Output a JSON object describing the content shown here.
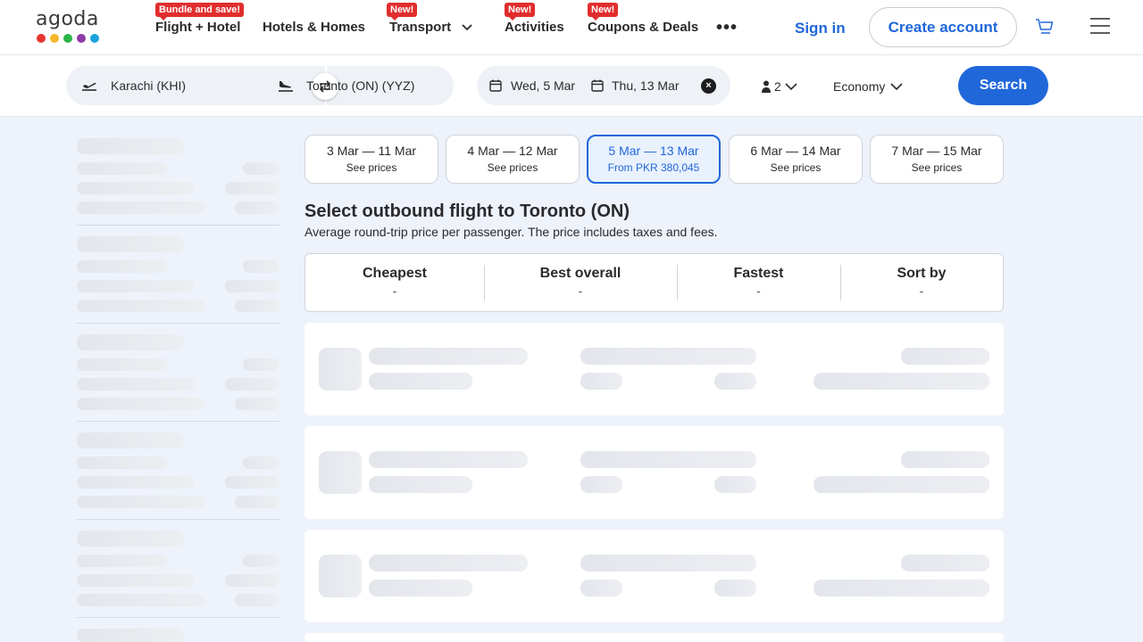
{
  "header": {
    "logo": {
      "text": "agoda",
      "dots": [
        "#e8352f",
        "#f6b82a",
        "#2cb34a",
        "#8e3ba6",
        "#1ca3de"
      ]
    },
    "nav": [
      {
        "label": "Flight + Hotel",
        "badge": "Bundle and save!"
      },
      {
        "label": "Hotels & Homes",
        "badge": ""
      },
      {
        "label": "Transport",
        "badge": "New!",
        "has_dropdown": true
      },
      {
        "label": "Activities",
        "badge": "New!"
      },
      {
        "label": "Coupons & Deals",
        "badge": "New!"
      }
    ],
    "more_label": "•••",
    "sign_in": "Sign in",
    "create_account": "Create account"
  },
  "search": {
    "from": "Karachi (KHI)",
    "to": "Toronto (ON) (YYZ)",
    "depart": "Wed, 5 Mar",
    "return": "Thu, 13 Mar",
    "clear_icon": "×",
    "passengers": "2",
    "cabin": "Economy",
    "button": "Search"
  },
  "date_options": [
    {
      "range": "3 Mar — 11 Mar",
      "sub": "See prices",
      "active": false
    },
    {
      "range": "4 Mar — 12 Mar",
      "sub": "See prices",
      "active": false
    },
    {
      "range": "5 Mar — 13 Mar",
      "sub": "From PKR 380,045",
      "active": true
    },
    {
      "range": "6 Mar — 14 Mar",
      "sub": "See prices",
      "active": false
    },
    {
      "range": "7 Mar — 15 Mar",
      "sub": "See prices",
      "active": false
    }
  ],
  "results": {
    "heading": "Select outbound flight to Toronto (ON)",
    "subheading": "Average round-trip price per passenger. The price includes taxes and fees."
  },
  "sort": [
    {
      "label": "Cheapest",
      "value": "-"
    },
    {
      "label": "Best overall",
      "value": "-"
    },
    {
      "label": "Fastest",
      "value": "-"
    },
    {
      "label": "Sort by",
      "value": "-"
    }
  ],
  "colors": {
    "brand_blue": "#2067da",
    "badge_red": "#e12d2d",
    "page_bg": "#eef2fa"
  }
}
